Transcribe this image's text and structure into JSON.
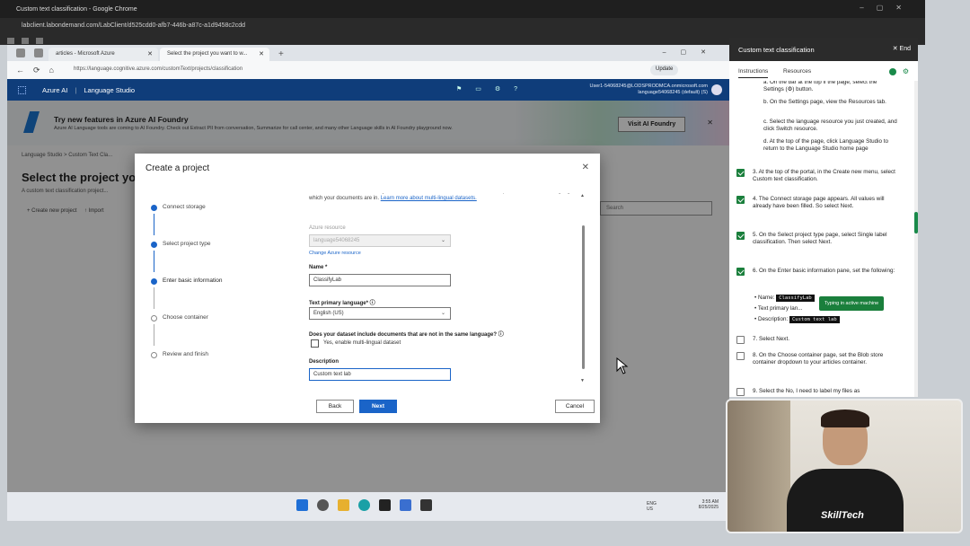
{
  "outer_window": {
    "title": "Custom text classification - Google Chrome",
    "url": "labclient.labondemand.com/LabClient/d525cdd0-afb7-446b-a87c-a1d9458c2cdd"
  },
  "edge": {
    "tabs": [
      {
        "label": "articles - Microsoft Azure"
      },
      {
        "label": "Select the project you want to w..."
      }
    ],
    "url": "https://language.cognitive.azure.com/customText/projects/classification",
    "update_label": "Update"
  },
  "azure_bar": {
    "brand": "Azure AI",
    "product": "Language Studio",
    "user_line1": "User1-54068245@LODSPRODMCA.onmicrosoft.com",
    "user_line2": "language54068245 (default) (S)"
  },
  "banner": {
    "title": "Try new features in Azure AI Foundry",
    "subtitle": "Azure AI Language tools are coming to AI Foundry. Check out Extract PII from conversation, Summarize for call center, and many other Language skills in AI Foundry playground now.",
    "button": "Visit AI Foundry"
  },
  "page": {
    "breadcrumb": "Language Studio  >  Custom Text Cla...",
    "title": "Select the project you",
    "subtitle": "A custom text classification project...",
    "cmd_new": "+ Create new project",
    "cmd_import": "↑ Import",
    "search_placeholder": "Search"
  },
  "dialog": {
    "title": "Create a project",
    "steps": [
      {
        "label": "Connect storage",
        "done": true
      },
      {
        "label": "Select project type",
        "done": true
      },
      {
        "label": "Enter basic information",
        "done": true
      },
      {
        "label": "Choose container",
        "done": false
      },
      {
        "label": "Review and finish",
        "done": false
      }
    ],
    "intro": "Enter the basic information for your custom text classification model. Add a description and select the language which your documents are in.",
    "intro_link": "Learn more about multi-lingual datasets.",
    "azure_resource_label": "Azure resource",
    "azure_resource_value": "language54068245",
    "change_resource_link": "Change Azure resource",
    "name_label": "Name *",
    "name_value": "ClassifyLab",
    "language_label": "Text primary language*",
    "language_value": "English (US)",
    "multilingual_question": "Does your dataset include documents that are not in the same language?",
    "multilingual_checkbox": "Yes, enable multi-lingual dataset",
    "description_label": "Description",
    "description_value": "Custom text lab",
    "back_button": "Back",
    "next_button": "Next",
    "cancel_button": "Cancel"
  },
  "taskbar": {
    "lang1": "ENG",
    "lang2": "US",
    "time": "3:55 AM",
    "date": "8/25/2025"
  },
  "lab_panel": {
    "title": "Custom text classification",
    "end_label": "End",
    "tab_instructions": "Instructions",
    "tab_resources": "Resources",
    "sub_a": "a. On the bar at the top if the page, select the Settings (⚙) button.",
    "sub_b": "b. On the Settings page, view the Resources tab.",
    "sub_c": "c. Select the language resource you just created, and click Switch resource.",
    "sub_d": "d. At the top of the page, click Language Studio to return to the Language Studio home page",
    "step3": "3. At the top of the portal, in the Create new menu, select Custom text classification.",
    "step4": "4. The Connect storage page appears. All values will already have been filled. So select Next.",
    "step5": "5. On the Select project type page, select Single label classification. Then select Next.",
    "step6": "6. On the Enter basic information pane, set the following:",
    "bullet_name_label": "Name:",
    "bullet_name_code": "ClassifyLab",
    "bullet_lang_label": "Text primary lan...",
    "bullet_desc_label": "Description:",
    "bullet_desc_code": "Custom text lab",
    "tooltip": "Typing in active machine",
    "step7": "7. Select Next.",
    "step8": "8. On the Choose container page, set the Blob store container dropdown to your articles container.",
    "step9": "9. Select the No, I need to label my files as"
  },
  "webcam": {
    "shirt_text": "SkillTech"
  }
}
